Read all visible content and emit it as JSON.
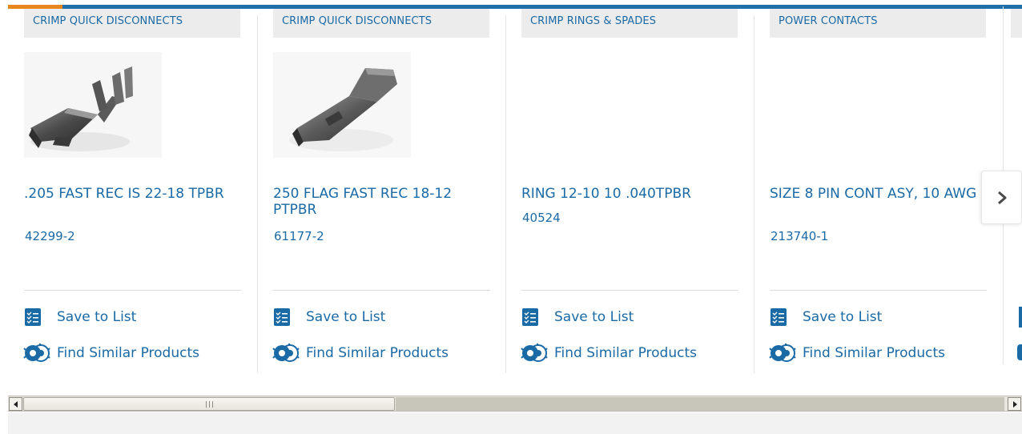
{
  "carousel": {
    "products": [
      {
        "category": "CRIMP QUICK DISCONNECTS",
        "title": ".205 FAST REC IS 22-18 TPBR",
        "part_number": "42299-2",
        "save_label": "Save to List",
        "similar_label": "Find Similar Products",
        "image": "crimp-receptacle-photo"
      },
      {
        "category": "CRIMP QUICK DISCONNECTS",
        "title": "250 FLAG FAST REC 18-12 PTPBR",
        "part_number": "61177-2",
        "save_label": "Save to List",
        "similar_label": "Find Similar Products",
        "image": "flag-receptacle-photo"
      },
      {
        "category": "CRIMP RINGS & SPADES",
        "title": "RING 12-10 10 .040TPBR",
        "part_number": "40524",
        "save_label": "Save to List",
        "similar_label": "Find Similar Products",
        "image": ""
      },
      {
        "category": "POWER CONTACTS",
        "title": "SIZE 8 PIN CONT ASY, 10 AWG",
        "part_number": "213740-1",
        "save_label": "Save to List",
        "similar_label": "Find Similar Products",
        "image": ""
      }
    ],
    "next_icon": "chevron-right-icon"
  },
  "colors": {
    "link_blue": "#1a6aa6",
    "accent_orange": "#e8871e",
    "bar_blue": "#1f6fa8",
    "tag_gray": "#ececec"
  },
  "scrollbar": {
    "left_icon": "arrow-left-icon",
    "right_icon": "arrow-right-icon",
    "thumb_position": 0.0
  }
}
